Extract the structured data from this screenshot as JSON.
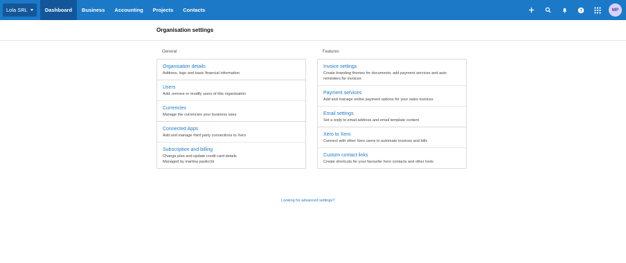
{
  "topbar": {
    "org_name": "Lola SRL",
    "nav": [
      "Dashboard",
      "Business",
      "Accounting",
      "Projects",
      "Contacts"
    ],
    "active_nav": "Dashboard",
    "icons": [
      "plus-icon",
      "search-icon",
      "bell-icon",
      "help-icon",
      "apps-grid-icon"
    ],
    "avatar_initials": "MP",
    "brand_color": "#1b79c8"
  },
  "page": {
    "title": "Organisation settings"
  },
  "general": {
    "label": "General",
    "cards": [
      [
        {
          "title": "Organisation details",
          "desc": [
            "Address, logo and basic financial information"
          ]
        }
      ],
      [
        {
          "title": "Users",
          "desc": [
            "Add, remove or modify users of this organisation"
          ]
        },
        {
          "title": "Currencies",
          "desc": [
            "Manage the currencies your business uses"
          ]
        }
      ],
      [
        {
          "title": "Connected Apps",
          "desc": [
            "Add and manage third party connections to Xero"
          ]
        },
        {
          "title": "Subscription and billing",
          "desc": [
            "Change plan and update credit card details",
            "Managed by martina paolicchi"
          ]
        }
      ]
    ]
  },
  "features": {
    "label": "Features",
    "cards": [
      [
        {
          "title": "Invoice settings",
          "desc": [
            "Create branding themes for documents, add payment services and auto",
            "reminders for invoices"
          ]
        },
        {
          "title": "Payment services",
          "desc": [
            "Add and manage online payment options for your sales invoices"
          ]
        },
        {
          "title": "Email settings",
          "desc": [
            "Set a reply to email address and email template content"
          ]
        }
      ],
      [
        {
          "title": "Xero to Xero",
          "desc": [
            "Connect with other Xero users to automate invoices and bills"
          ]
        },
        {
          "title": "Custom contact links",
          "desc": [
            "Create shortcuts for your favourite Xero contacts and other tools"
          ]
        }
      ]
    ]
  },
  "footer": {
    "advanced_link": "Looking for advanced settings?"
  }
}
